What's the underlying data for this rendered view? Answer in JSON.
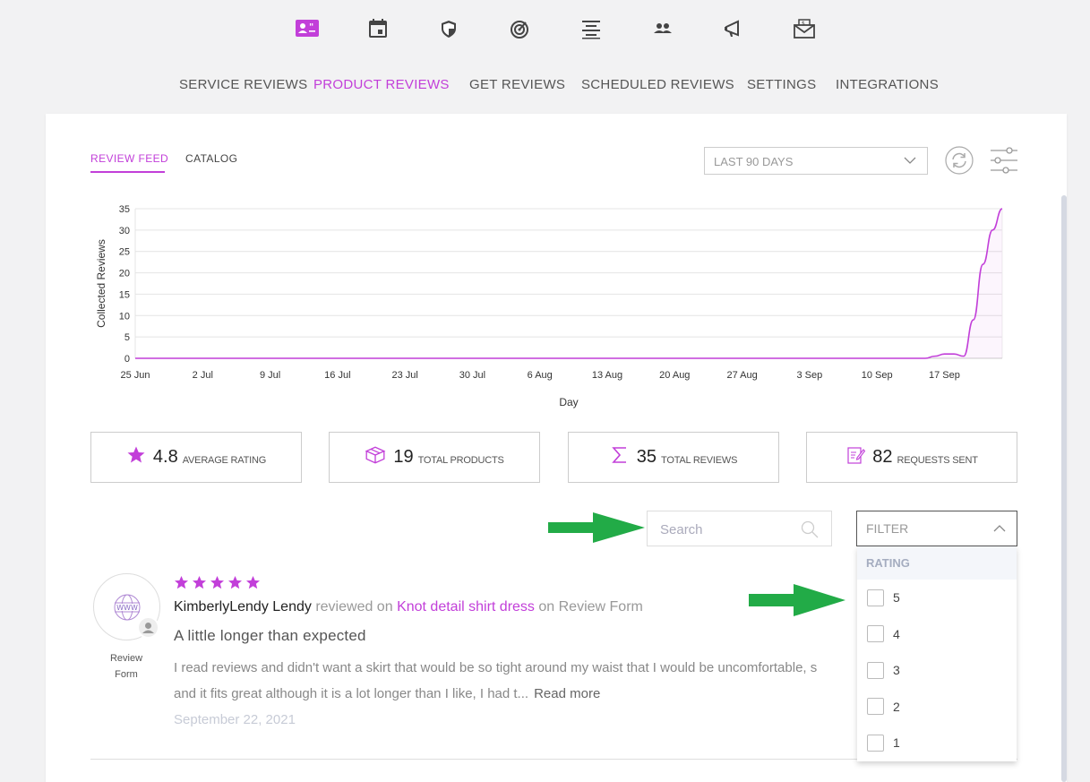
{
  "top_icons": [
    {
      "name": "reviews-icon",
      "active": true
    },
    {
      "name": "calendar-icon",
      "active": false
    },
    {
      "name": "shield-icon",
      "active": false
    },
    {
      "name": "target-icon",
      "active": false
    },
    {
      "name": "align-center-icon",
      "active": false
    },
    {
      "name": "people-icon",
      "active": false
    },
    {
      "name": "megaphone-icon",
      "active": false
    },
    {
      "name": "mail-icon",
      "active": false
    }
  ],
  "nav": {
    "service_reviews": "SERVICE REVIEWS",
    "product_reviews": "PRODUCT REVIEWS",
    "get_reviews": "GET REVIEWS",
    "scheduled_reviews": "SCHEDULED REVIEWS",
    "settings": "SETTINGS",
    "integrations": "INTEGRATIONS",
    "active": "PRODUCT REVIEWS"
  },
  "tabs": {
    "review_feed": "REVIEW FEED",
    "catalog": "CATALOG",
    "active": "REVIEW FEED"
  },
  "range_select": {
    "value": "LAST 90 DAYS"
  },
  "colors": {
    "accent": "#c23fd9",
    "arrow": "#22ab47"
  },
  "chart_data": {
    "type": "line",
    "xlabel": "Day",
    "ylabel": "Collected Reviews",
    "ylim": [
      0,
      35
    ],
    "yticks": [
      0,
      5,
      10,
      15,
      20,
      25,
      30,
      35
    ],
    "xticks": [
      "25 Jun",
      "2 Jul",
      "9 Jul",
      "16 Jul",
      "23 Jul",
      "30 Jul",
      "6 Aug",
      "13 Aug",
      "20 Aug",
      "27 Aug",
      "3 Sep",
      "10 Sep",
      "17 Sep"
    ],
    "x": [
      "2021-06-25",
      "2021-09-15",
      "2021-09-16",
      "2021-09-17",
      "2021-09-18",
      "2021-09-19",
      "2021-09-20",
      "2021-09-21",
      "2021-09-22",
      "2021-09-23"
    ],
    "series": [
      {
        "values": [
          0,
          0,
          0.5,
          1,
          1,
          0.5,
          9,
          22,
          30,
          35
        ]
      }
    ],
    "grid": true,
    "legend": "none"
  },
  "stats": [
    {
      "icon": "star-icon",
      "value": "4.8",
      "label": "AVERAGE RATING"
    },
    {
      "icon": "box-icon",
      "value": "19",
      "label": "TOTAL PRODUCTS"
    },
    {
      "icon": "sigma-icon",
      "value": "35",
      "label": "TOTAL REVIEWS"
    },
    {
      "icon": "request-icon",
      "value": "82",
      "label": "REQUESTS SENT"
    }
  ],
  "search": {
    "placeholder": "Search"
  },
  "filter": {
    "label": "FILTER",
    "section": "RATING",
    "options": [
      "5",
      "4",
      "3",
      "2",
      "1"
    ]
  },
  "review": {
    "rating": 5,
    "reviewer": "KimberlyLendy Lendy",
    "reviewed_on": "reviewed on",
    "product": "Knot detail shirt dress",
    "on_source": "on Review Form",
    "source_label_1": "Review",
    "source_label_2": "Form",
    "title": "A little longer than expected",
    "body_line1": "I read reviews and didn't want a skirt that would be so tight around my waist that I would be uncomfortable, s",
    "body_line2": "and it fits great although it is a lot longer than I like, I had t...",
    "read_more": "Read more",
    "date": "September 22, 2021"
  }
}
